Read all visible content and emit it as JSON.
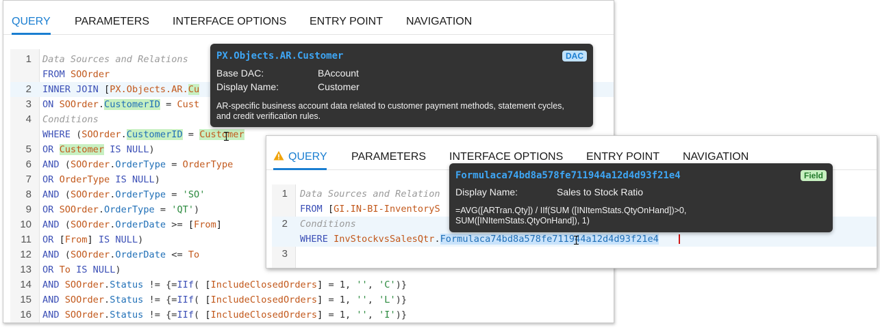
{
  "panel1": {
    "tabs": [
      "QUERY",
      "PARAMETERS",
      "INTERFACE OPTIONS",
      "ENTRY POINT",
      "NAVIGATION"
    ],
    "line_numbers": [
      "1",
      "2",
      "3",
      "4",
      "5",
      "6",
      "7",
      "8",
      "9",
      "10",
      "11",
      "12",
      "13",
      "14",
      "15",
      "16"
    ],
    "tooltip": {
      "title": "PX.Objects.AR.Customer",
      "badge": "DAC",
      "rows": [
        {
          "key": "Base DAC:",
          "value": "BAccount"
        },
        {
          "key": "Display Name:",
          "value": "Customer"
        }
      ],
      "description": "AR-specific business account data related to customer payment methods, statement cycles, and credit verification rules."
    }
  },
  "panel2": {
    "tabs": [
      "QUERY",
      "PARAMETERS",
      "INTERFACE OPTIONS",
      "ENTRY POINT",
      "NAVIGATION"
    ],
    "line_numbers": [
      "1",
      "2",
      "3"
    ],
    "tooltip": {
      "title": "Formulaca74bd8a578fe711944a12d4d93f21e4",
      "badge": "Field",
      "rows": [
        {
          "key": "Display Name:",
          "value": "Sales to Stock Ratio"
        }
      ],
      "description": "=AVG([ARTran.Qty]) / IIf(SUM ([INItemStats.QtyOnHand])>0, SUM([INItemStats.QtyOnHand]), 1)"
    }
  },
  "colors": {
    "accent": "#1a7ed1",
    "warning": "#f0a30a",
    "tooltip_bg": "#333333",
    "keyword": "#3b4fb6",
    "table": "#c2581b",
    "field": "#1f6fb7",
    "string": "#2b8a3e",
    "comment": "#9a9a9a"
  },
  "icons": [
    "warning-icon",
    "text-cursor-icon"
  ]
}
